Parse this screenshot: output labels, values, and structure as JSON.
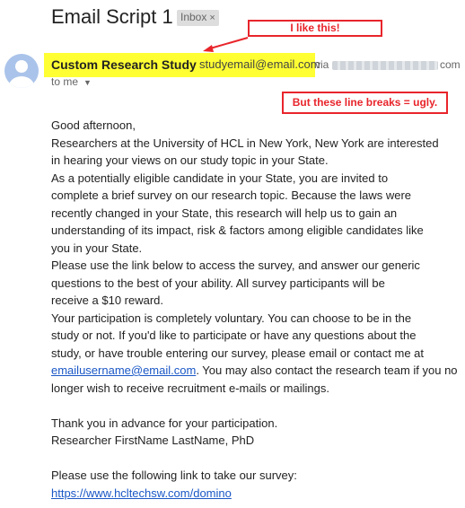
{
  "email": {
    "subject": "Email Script 1",
    "label": "Inbox",
    "label_close": "×",
    "sender_name": "Custom Research Study",
    "sender_email": "studyemail@email.com",
    "via_prefix": "via",
    "via_suffix": "com",
    "recipient": "to me",
    "body_lines": [
      "Good afternoon,",
      "Researchers at the University of HCL in New York, New York are interested",
      "in hearing your views on our study topic in your State.",
      "As a potentially eligible candidate in your State, you are invited to",
      "complete a brief survey on our research topic. Because the laws were",
      "recently changed in your State, this research will help us to gain an",
      "understanding of its impact, risk & factors among eligible candidates like",
      "you in your State.",
      "Please use the link below to access the survey, and answer our generic",
      "questions to the best of your ability. All survey participants will be",
      "receive a $10 reward.",
      "Your participation is completely voluntary. You can choose to be in the",
      "study or not. If you'd like to participate or have any questions about the",
      "study, or have trouble entering our survey, please email or contact me at"
    ],
    "contact_email": "emailusername@email.com",
    "contact_after": ". You may also contact the research team if you no",
    "body_line_16": "longer wish to receive recruitment e-mails or mailings.",
    "thanks": "Thank you in advance for your participation.",
    "signature": "Researcher FirstName LastName, PhD",
    "survey_prompt": "Please use the following link to take our survey:",
    "survey_link": "https://www.hcltechsw.com/domino"
  },
  "annotations": {
    "note1": "I like this!",
    "note2": "But these line breaks = ugly."
  },
  "colors": {
    "annotation_red": "#e8252b",
    "highlight_yellow": "#ffff33",
    "link_blue": "#1a57c6",
    "avatar_bg": "#aac3ea"
  }
}
